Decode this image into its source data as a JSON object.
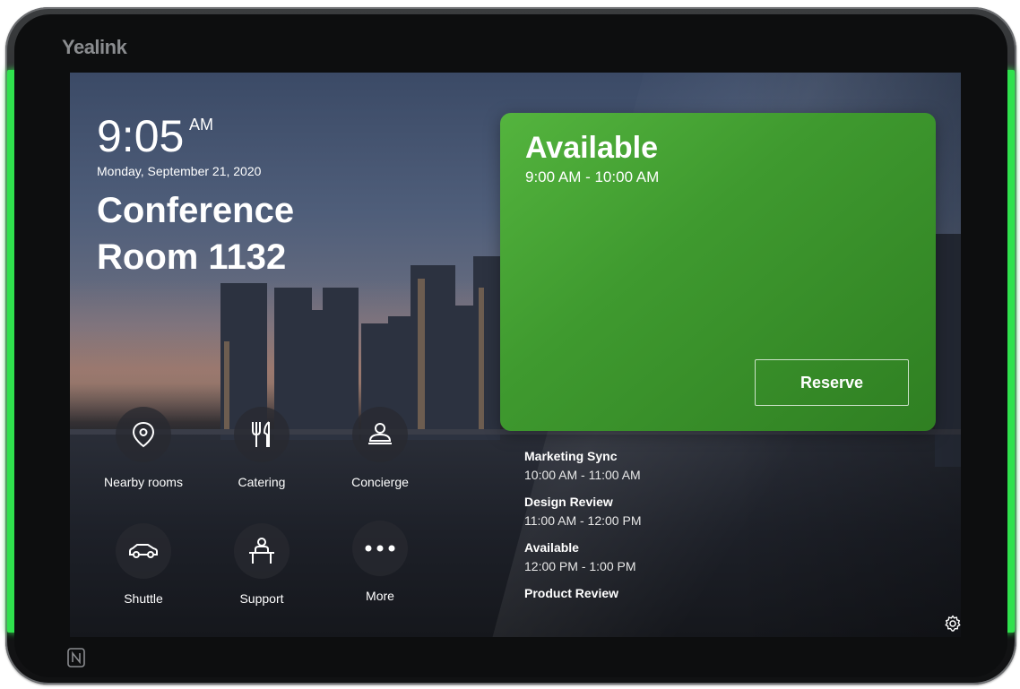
{
  "device": {
    "brand": "Yealink",
    "led_color": "#2fe24d"
  },
  "header": {
    "time": "9:05",
    "ampm": "AM",
    "date": "Monday, September 21, 2020",
    "room_line1": "Conference",
    "room_line2": "Room 1132"
  },
  "status": {
    "title": "Available",
    "time_range": "9:00 AM - 10:00 AM",
    "reserve_label": "Reserve",
    "color": "#4aa838"
  },
  "actions": [
    {
      "label": "Nearby rooms",
      "icon": "location-pin-icon"
    },
    {
      "label": "Catering",
      "icon": "fork-knife-icon"
    },
    {
      "label": "Concierge",
      "icon": "concierge-bell-icon"
    },
    {
      "label": "Shuttle",
      "icon": "car-icon"
    },
    {
      "label": "Support",
      "icon": "support-person-icon"
    },
    {
      "label": "More",
      "icon": "more-dots-icon"
    }
  ],
  "schedule": [
    {
      "title": "Marketing Sync",
      "time": "10:00 AM - 11:00 AM"
    },
    {
      "title": "Design Review",
      "time": "11:00 AM - 12:00 PM"
    },
    {
      "title": "Available",
      "time": "12:00 PM - 1:00 PM"
    },
    {
      "title": "Product Review",
      "time": ""
    }
  ]
}
